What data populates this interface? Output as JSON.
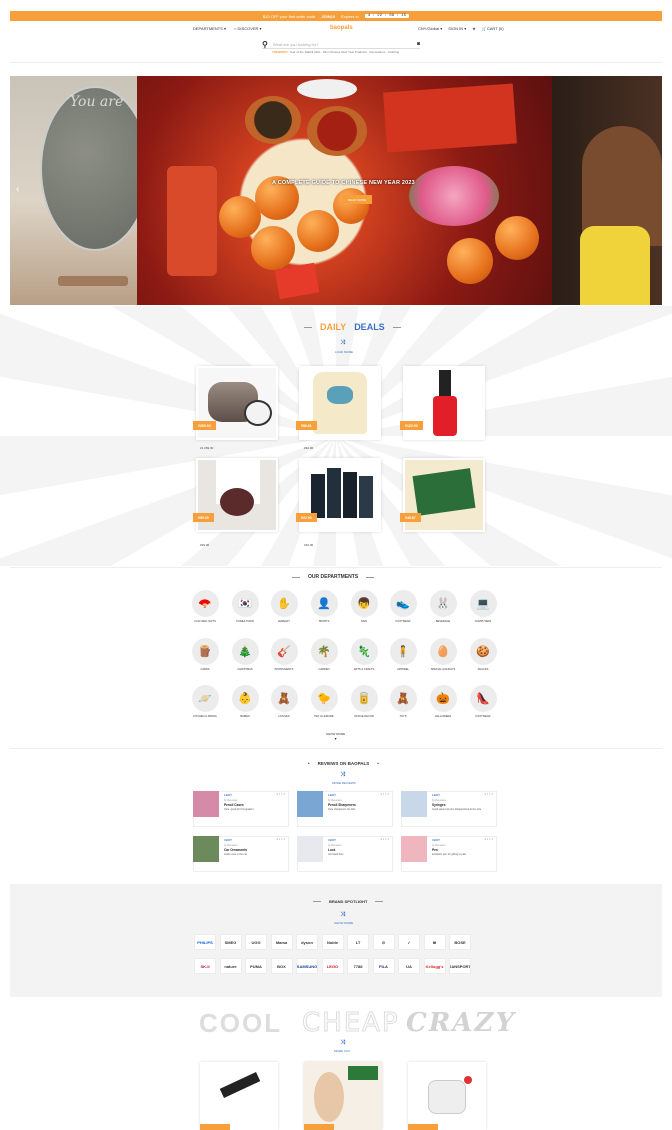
{
  "promo": {
    "text": "$10 OFF your first order code",
    "code": "JOIN10",
    "expires_label": "Expires in",
    "timer": "4 : 22 : 08 : 15"
  },
  "nav": {
    "departments": "DEPARTMENTS ▾",
    "discover": "DISCOVER ▾",
    "logo": "baopals",
    "currency": "CNY/Global ▾",
    "signin": "SIGN IN ▾",
    "cart": "CART (0)"
  },
  "search": {
    "placeholder": "What are you looking for?",
    "trending_label": "TRENDING:",
    "trending": "Year of the Rabbit Gifts · Mini Chinese New Year Products · Decorations · Clothing"
  },
  "hero": {
    "headline": "A COMPLETE GUIDE TO CHINESE NEW YEAR 2023",
    "button": "READ MORE",
    "left_slide_text": "You are"
  },
  "daily": {
    "title_a": "DAILY",
    "title_b": "DEALS",
    "load": "LOAD MORE",
    "items": [
      {
        "price": "¥359.54",
        "was": "¥1,069.00"
      },
      {
        "price": "¥88.81",
        "was": "¥92.00"
      },
      {
        "price": "¥122.00",
        "was": ""
      },
      {
        "price": "¥99.00",
        "was": "¥99.00"
      },
      {
        "price": "¥22.90",
        "was": "¥40.00"
      },
      {
        "price": "¥45.87",
        "was": ""
      }
    ]
  },
  "departments": {
    "title": "OUR DEPARTMENTS",
    "show_more": "SHOW MORE",
    "items": [
      "Cultural Gifts",
      "Korea Town",
      "Jewelry",
      "Sports",
      "Skin",
      "Footwear",
      "Beverage",
      "Computers",
      "Cards",
      "Christmas",
      "Instruments",
      "Garden",
      "Arts & Crafts",
      "Apparel",
      "Special Holidays",
      "Snacks",
      "Kitchen & Dining",
      "Babies",
      "Houses",
      "Pet & Leisure",
      "Office Decor",
      "Toys",
      "Halloween",
      "Footwear"
    ]
  },
  "reviews": {
    "title": "REVIEWS ON BAOPALS",
    "more": "MORE REVIEWS",
    "items": [
      {
        "buy": "I BUY",
        "by": "by Reviewer",
        "title": "Pencil Cases",
        "text": "Cute, good for first graders",
        "meta": "♥ 1  ✎ 1"
      },
      {
        "buy": "I BUY",
        "by": "by Reviewer",
        "title": "Pencil Sharpeners",
        "text": "Cute sharpeners for kids",
        "meta": "♥ 1  ✎ 1"
      },
      {
        "buy": "I BUY",
        "by": "by Reviewer",
        "title": "Syringes",
        "text": "Good value but pins disappointed at the size",
        "meta": "♥ 1  ✎ 1"
      },
      {
        "buy": "I BUY",
        "by": "by Reviewer",
        "title": "Car Ornaments",
        "text": "Looks cute in the car",
        "meta": "♥ 1  ✎ 1"
      },
      {
        "buy": "I BUY",
        "by": "by Reviewer",
        "title": "Lock",
        "text": "Unit itself love",
        "meta": "♥ 1  ✎ 1"
      },
      {
        "buy": "I BUY",
        "by": "by Reviewer",
        "title": "Pen",
        "text": "Fantastic pen for gifting to pals",
        "meta": "♥ 1  ✎ 1"
      }
    ]
  },
  "brands": {
    "title": "BRAND SPOTLIGHT",
    "more": "SHOW MORE",
    "row1": [
      "PHILIPS",
      "SMEG",
      "UGG",
      "Mama",
      "dyson",
      "Noble",
      "LT",
      "⊙",
      "✓",
      "☠",
      "BOSE"
    ],
    "row2": [
      "SK-II",
      "nature",
      "PUMA",
      "BOX",
      "SAMSUNG",
      "LEGO",
      "7788",
      "FILA",
      "UA",
      "Kellogg's",
      "JANSPORT"
    ]
  },
  "ccc": {
    "w1": "COOL",
    "w2": "CHEAP",
    "w3": "CRAZY",
    "more": "MORE CCC"
  }
}
